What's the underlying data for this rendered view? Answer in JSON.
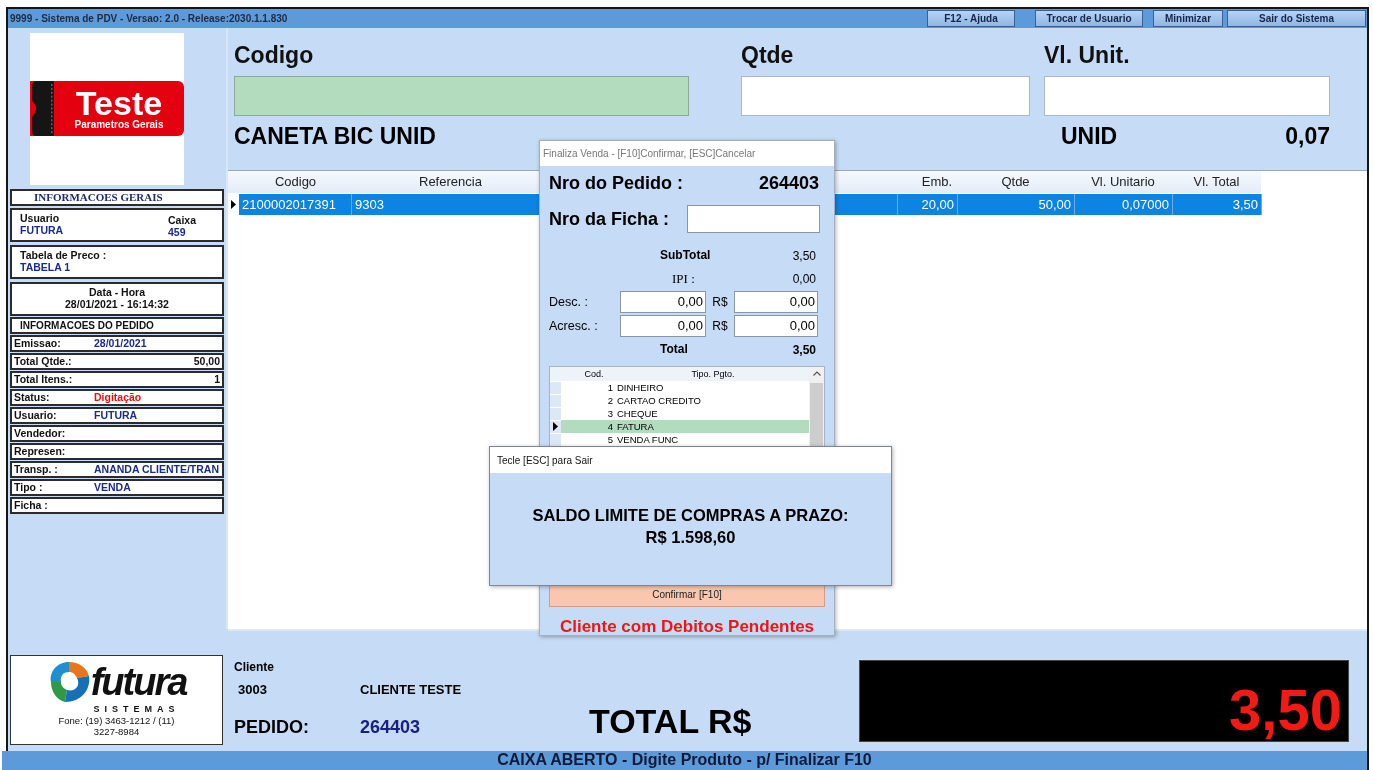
{
  "window": {
    "title": "9999 - Sistema de PDV - Versao: 2.0 - Release:2030.1.1.830"
  },
  "toolbar_buttons": [
    "F12 - Ajuda",
    "Trocar de Usuario",
    "Minimizar",
    "Sair do Sistema"
  ],
  "logo": {
    "name": "Teste",
    "subtitle": "Parametros Gerais"
  },
  "info_gerais": {
    "heading": "INFORMACOES GERAIS",
    "usuario_label": "Usuario",
    "usuario": "FUTURA",
    "caixa_label": "Caixa",
    "caixa": "459",
    "tabela_label": "Tabela de Preco :",
    "tabela": "TABELA 1",
    "datahora_label": "Data - Hora",
    "datahora": "28/01/2021 - 16:14:32"
  },
  "info_pedido": {
    "heading": "INFORMACOES DO PEDIDO",
    "rows": [
      {
        "label": "Emissao:",
        "value": "28/01/2021",
        "kind": "text"
      },
      {
        "label": "Total Qtde.:",
        "value": "50,00",
        "kind": "number"
      },
      {
        "label": "Total Itens.:",
        "value": "1",
        "kind": "number"
      },
      {
        "label": "Status:",
        "value": "Digitação",
        "kind": "status"
      },
      {
        "label": "Usuario:",
        "value": "FUTURA",
        "kind": "text"
      },
      {
        "label": "Vendedor:"
      },
      {
        "label": "Represen:"
      },
      {
        "label": "Transp. :",
        "value": "ANANDA CLIENTE/TRAN",
        "kind": "text"
      },
      {
        "label": "Tipo :",
        "value": "VENDA",
        "kind": "text"
      },
      {
        "label": "Ficha :"
      }
    ]
  },
  "vendor_logo": {
    "name": "futura",
    "tagline": "SISTEMAS",
    "phone": "Fone: (19) 3463-1212 / (11) 3227-8984"
  },
  "entry": {
    "fields": [
      {
        "label": "Codigo",
        "focused": true
      },
      {
        "label": "Qtde",
        "focused": false
      },
      {
        "label": "Vl. Unit.",
        "focused": false
      }
    ],
    "product": "CANETA BIC UNID",
    "unit": "UNID",
    "price": "0,07"
  },
  "items_table": {
    "columns": [
      {
        "label": "Codigo"
      },
      {
        "label": "Referencia"
      },
      {
        "label": "Emb."
      },
      {
        "label": "Qtde"
      },
      {
        "label": "Vl. Unitario"
      },
      {
        "label": "Vl. Total"
      }
    ],
    "rows": [
      {
        "selected": true,
        "cells": [
          "2100002017391",
          "9303",
          "20,00",
          "50,00",
          "0,07000",
          "3,50"
        ]
      }
    ]
  },
  "finaliza_dialog": {
    "title": "Finaliza Venda - [F10]Confirmar, [ESC]Cancelar",
    "pedido_label": "Nro do Pedido :",
    "pedido": "264403",
    "ficha_label": "Nro da Ficha :",
    "subtotal_label": "SubTotal",
    "subtotal": "3,50",
    "ipi_label": "IPI :",
    "ipi": "0,00",
    "adjustments": [
      {
        "label": "Desc. :",
        "percent": "0,00",
        "currency": "R$",
        "amount": "0,00"
      },
      {
        "label": "Acresc. :",
        "percent": "0,00",
        "currency": "R$",
        "amount": "0,00"
      }
    ],
    "total_label": "Total",
    "total": "3,50",
    "payments": {
      "columns": [
        "Cod.",
        "Tipo. Pgto."
      ],
      "rows": [
        {
          "code": "1",
          "name": "DINHEIRO",
          "selected": false
        },
        {
          "code": "2",
          "name": "CARTAO CREDITO",
          "selected": false
        },
        {
          "code": "3",
          "name": "CHEQUE",
          "selected": false
        },
        {
          "code": "4",
          "name": "FATURA",
          "selected": true
        },
        {
          "code": "5",
          "name": "VENDA FUNC",
          "selected": false
        }
      ]
    },
    "confirm_button": "Confirmar [F10]",
    "warning": "Cliente com Debitos Pendentes"
  },
  "limit_popup": {
    "title": "Tecle [ESC] para Sair",
    "message": "SALDO LIMITE DE COMPRAS A PRAZO:",
    "amount": "R$ 1.598,60"
  },
  "footer": {
    "cliente_label": "Cliente",
    "cliente_code": "3003",
    "cliente_name": "CLIENTE TESTE",
    "pedido_label": "PEDIDO:",
    "pedido": "264403",
    "total_label": "TOTAL R$",
    "total": "3,50"
  },
  "status_bar": "CAIXA ABERTO - Digite Produto - p/ Finalizar F10"
}
